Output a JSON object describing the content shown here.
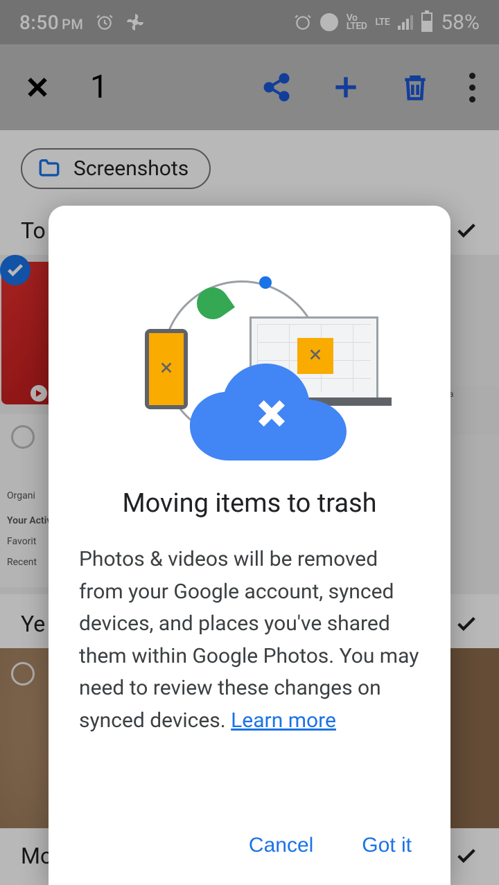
{
  "status": {
    "time": "8:50",
    "ampm": "PM",
    "battery_pct": "58%"
  },
  "toolbar": {
    "selected_count": "1"
  },
  "chip": {
    "label": "Screenshots"
  },
  "sections": {
    "today": "To",
    "yesterday": "Ye",
    "monday": "Mo"
  },
  "background": {
    "organize": "Organi",
    "activity": "Your Activit",
    "favorite": "Favorit",
    "recent": "Recent",
    "ta": "ta"
  },
  "dialog": {
    "title": "Moving items to trash",
    "body": "Photos & videos will be removed from your Google account, synced devices, and places you've shared them within Google Photos. You may need to review these changes on synced devices. ",
    "learn_more": "Learn more",
    "cancel": "Cancel",
    "confirm": "Got it"
  }
}
